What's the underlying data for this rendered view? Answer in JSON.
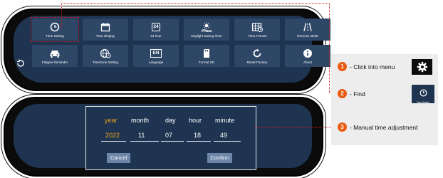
{
  "menu": {
    "tiles": [
      {
        "label": "Time Setting",
        "icon": "clock-icon"
      },
      {
        "label": "Time Display",
        "icon": "calendar-icon"
      },
      {
        "label": "24 hour",
        "icon": "24-hour-icon",
        "icon_text": "24"
      },
      {
        "label": "Daylight Saving Time",
        "icon": "sun-icon"
      },
      {
        "label": "Time Format",
        "icon": "grid-clock-icon"
      },
      {
        "label": "Reverse Mode",
        "icon": "road-icon"
      },
      {
        "label": "Fatigue Reminder",
        "icon": "car-icon"
      },
      {
        "label": "TimeZone Setting",
        "icon": "globe-clock-icon"
      },
      {
        "label": "Language",
        "icon": "language-icon",
        "icon_text": "EN"
      },
      {
        "label": "Format SD",
        "icon": "sd-card-icon"
      },
      {
        "label": "Reset Factory",
        "icon": "reset-icon"
      },
      {
        "label": "About",
        "icon": "info-icon"
      }
    ],
    "back_icon": "back-arrow-icon"
  },
  "dialog": {
    "headers": [
      "year",
      "month",
      "day",
      "hour",
      "minute"
    ],
    "values": [
      "2022",
      "11",
      "07",
      "18",
      "49"
    ],
    "cancel": "Cancel",
    "confirm": "Confirm"
  },
  "steps": [
    {
      "num": "1",
      "text": "- Click into menu"
    },
    {
      "num": "2",
      "text": "- Find"
    },
    {
      "num": "3",
      "text": "- Manual time adjustment"
    }
  ],
  "mini_tile_label": "Time Setting",
  "colors": {
    "screen": "#1f3450",
    "tile": "#2e4767",
    "highlight": "#e6a01e",
    "accent": "#ea5b11",
    "dotted": "#d41e1e"
  }
}
